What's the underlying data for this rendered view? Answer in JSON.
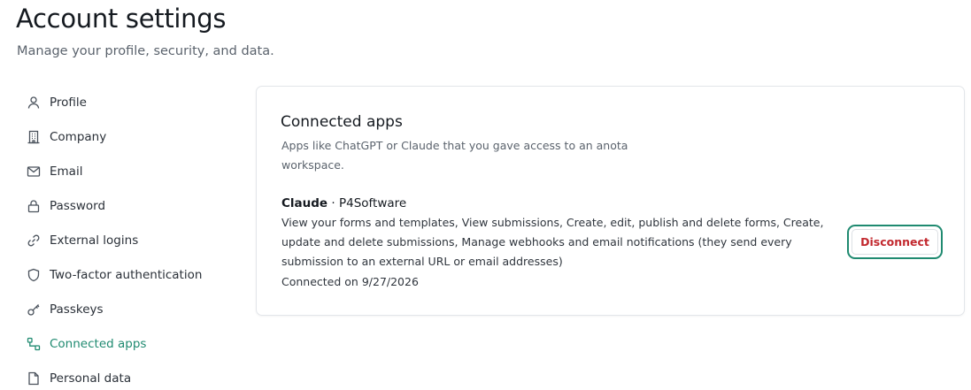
{
  "header": {
    "title": "Account settings",
    "subtitle": "Manage your profile, security, and data."
  },
  "sidebar": {
    "items": [
      {
        "label": "Profile",
        "icon": "user-icon",
        "active": false
      },
      {
        "label": "Company",
        "icon": "building-icon",
        "active": false
      },
      {
        "label": "Email",
        "icon": "mail-icon",
        "active": false
      },
      {
        "label": "Password",
        "icon": "lock-icon",
        "active": false
      },
      {
        "label": "External logins",
        "icon": "link-icon",
        "active": false
      },
      {
        "label": "Two-factor authentication",
        "icon": "shield-icon",
        "active": false
      },
      {
        "label": "Passkeys",
        "icon": "key-icon",
        "active": false
      },
      {
        "label": "Connected apps",
        "icon": "connected-apps-icon",
        "active": true
      },
      {
        "label": "Personal data",
        "icon": "file-icon",
        "active": false
      }
    ]
  },
  "card": {
    "title": "Connected apps",
    "description": "Apps like ChatGPT or Claude that you gave access to an anota workspace.",
    "apps": [
      {
        "name": "Claude",
        "separator": "·",
        "publisher": "P4Software",
        "permissions": "View your forms and templates, View submissions, Create, edit, publish and delete forms, Create, update and delete submissions, Manage webhooks and email notifications (they send every submission to an external URL or email addresses)",
        "connected": "Connected on 9/27/2026",
        "disconnect_label": "Disconnect"
      }
    ]
  },
  "colors": {
    "accent": "#1f8a70",
    "danger": "#c2282e",
    "text": "#151a20",
    "muted": "#5b636d"
  }
}
